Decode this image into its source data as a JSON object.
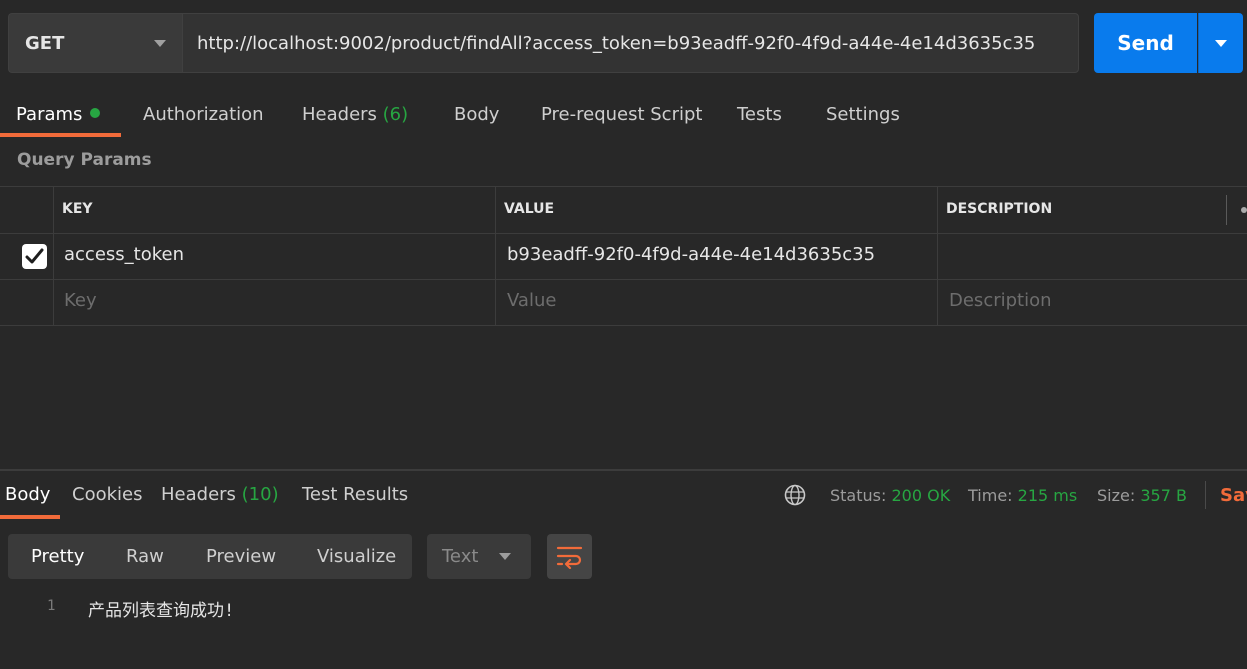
{
  "request": {
    "method": "GET",
    "url": "http://localhost:9002/product/findAll?access_token=b93eadff-92f0-4f9d-a44e-4e14d3635c35",
    "send_label": "Send"
  },
  "tabs": [
    {
      "label": "Params",
      "count": ""
    },
    {
      "label": "Authorization",
      "count": ""
    },
    {
      "label": "Headers",
      "count": "(6)"
    },
    {
      "label": "Body",
      "count": ""
    },
    {
      "label": "Pre-request Script",
      "count": ""
    },
    {
      "label": "Tests",
      "count": ""
    },
    {
      "label": "Settings",
      "count": ""
    }
  ],
  "query_params": {
    "title": "Query Params",
    "headers": {
      "key": "KEY",
      "value": "VALUE",
      "description": "DESCRIPTION"
    },
    "rows": [
      {
        "checked": true,
        "key": "access_token",
        "value": "b93eadff-92f0-4f9d-a44e-4e14d3635c35",
        "description": ""
      }
    ],
    "placeholders": {
      "key": "Key",
      "value": "Value",
      "description": "Description"
    }
  },
  "response": {
    "tabs": [
      {
        "label": "Body",
        "count": ""
      },
      {
        "label": "Cookies",
        "count": ""
      },
      {
        "label": "Headers",
        "count": "(10)"
      },
      {
        "label": "Test Results",
        "count": ""
      }
    ],
    "status_label": "Status:",
    "status_value": "200 OK",
    "time_label": "Time:",
    "time_value": "215 ms",
    "size_label": "Size:",
    "size_value": "357 B",
    "save_label": "Sav",
    "view_modes": [
      "Pretty",
      "Raw",
      "Preview",
      "Visualize"
    ],
    "format": "Text",
    "lines": [
      {
        "num": "1",
        "text": "产品列表查询成功!"
      }
    ]
  },
  "colors": {
    "accent": "#f26b3a",
    "send": "#097bed",
    "success": "#27a642",
    "background": "#282828"
  }
}
